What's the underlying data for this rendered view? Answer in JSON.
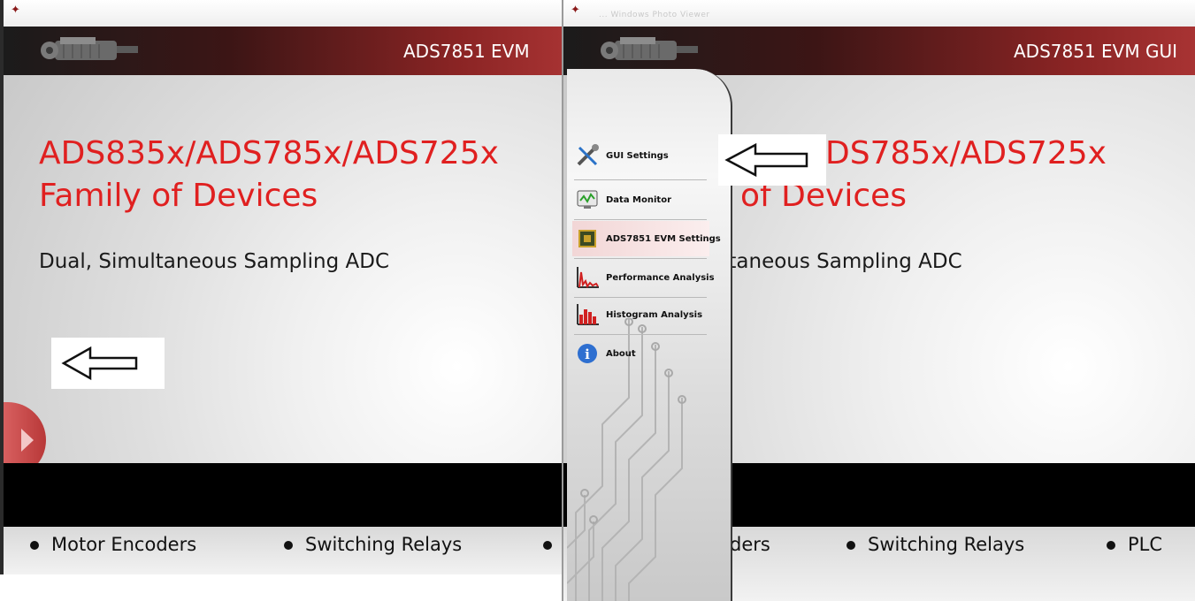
{
  "left_window": {
    "header_title": "ADS7851 EVM",
    "hero_line1": "ADS835x/ADS785x/ADS725x",
    "hero_line2": "Family of Devices",
    "subtitle": "Dual, Simultaneous Sampling ADC",
    "bullets": [
      "Motor Encoders",
      "Switching Relays"
    ]
  },
  "right_window": {
    "faint_title": "... Windows Photo Viewer",
    "header_title": "ADS7851 EVM GUI",
    "hero_line1": "DS785x/ADS725x",
    "hero_line2": "of Devices",
    "subtitle": "ltaneous Sampling ADC",
    "bullets": [
      "ders",
      "Switching Relays",
      "PLC"
    ],
    "menu": [
      {
        "label": "GUI Settings",
        "icon": "wrench-screwdriver-icon"
      },
      {
        "label": "Data Monitor",
        "icon": "monitor-icon"
      },
      {
        "label": "ADS7851 EVM Settings",
        "icon": "chip-icon",
        "selected": true
      },
      {
        "label": "Performance Analysis",
        "icon": "spectrum-chart-icon"
      },
      {
        "label": "Histogram Analysis",
        "icon": "histogram-icon"
      },
      {
        "label": "About",
        "icon": "info-icon"
      }
    ]
  },
  "colors": {
    "header_dark": "#1b1b1b",
    "header_red": "#a83333",
    "hero_red": "#e02020",
    "menu_selected": "#f2d6d6"
  }
}
